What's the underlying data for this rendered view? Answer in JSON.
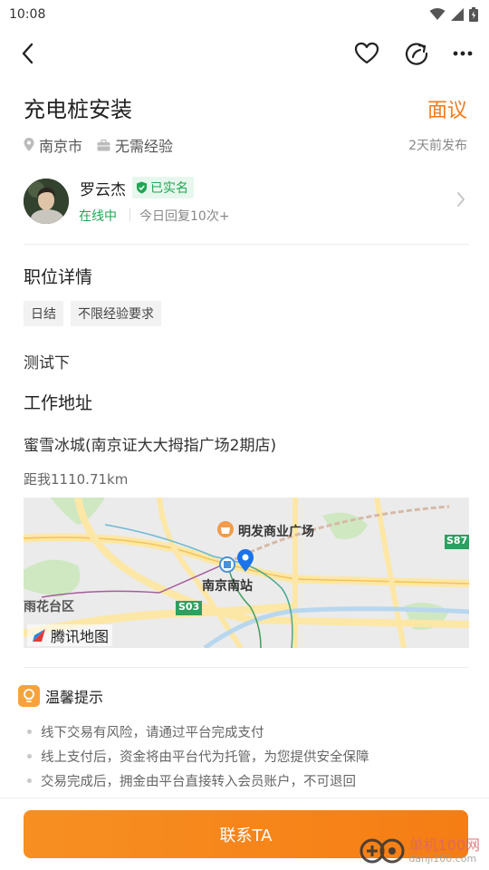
{
  "status_bar": {
    "time": "10:08"
  },
  "job": {
    "title": "充电桩安装",
    "salary": "面议",
    "city": "南京市",
    "experience": "无需经验",
    "posted": "2天前发布"
  },
  "poster": {
    "name": "罗云杰",
    "verified_label": "已实名",
    "online_label": "在线中",
    "reply_stats": "今日回复10次+"
  },
  "details": {
    "section_title": "职位详情",
    "tags": [
      "日结",
      "不限经验要求"
    ],
    "description": "测试下"
  },
  "address": {
    "section_title": "工作地址",
    "location": "蜜雪冰城(南京证大大拇指广场2期店)",
    "distance": "距我1110.71km"
  },
  "map": {
    "labels": {
      "mall": "明发商业广场",
      "station": "南京南站",
      "district": "雨花台区",
      "road_s03": "S03",
      "road_s87": "S87"
    },
    "brand": "腾讯地图"
  },
  "tips": {
    "title": "温馨提示",
    "items": [
      "线下交易有风险，请通过平台完成支付",
      "线上支付后，资金将由平台代为托管，为您提供安全保障",
      "交易完成后，拥金由平台直接转入会员账户，不可退回"
    ]
  },
  "footer": {
    "contact_label": "联系TA",
    "watermark": "单机100网",
    "watermark_sub": "danji100.com"
  },
  "colors": {
    "accent": "#f27a1a",
    "success": "#1fa653",
    "button": "#f78f22"
  }
}
